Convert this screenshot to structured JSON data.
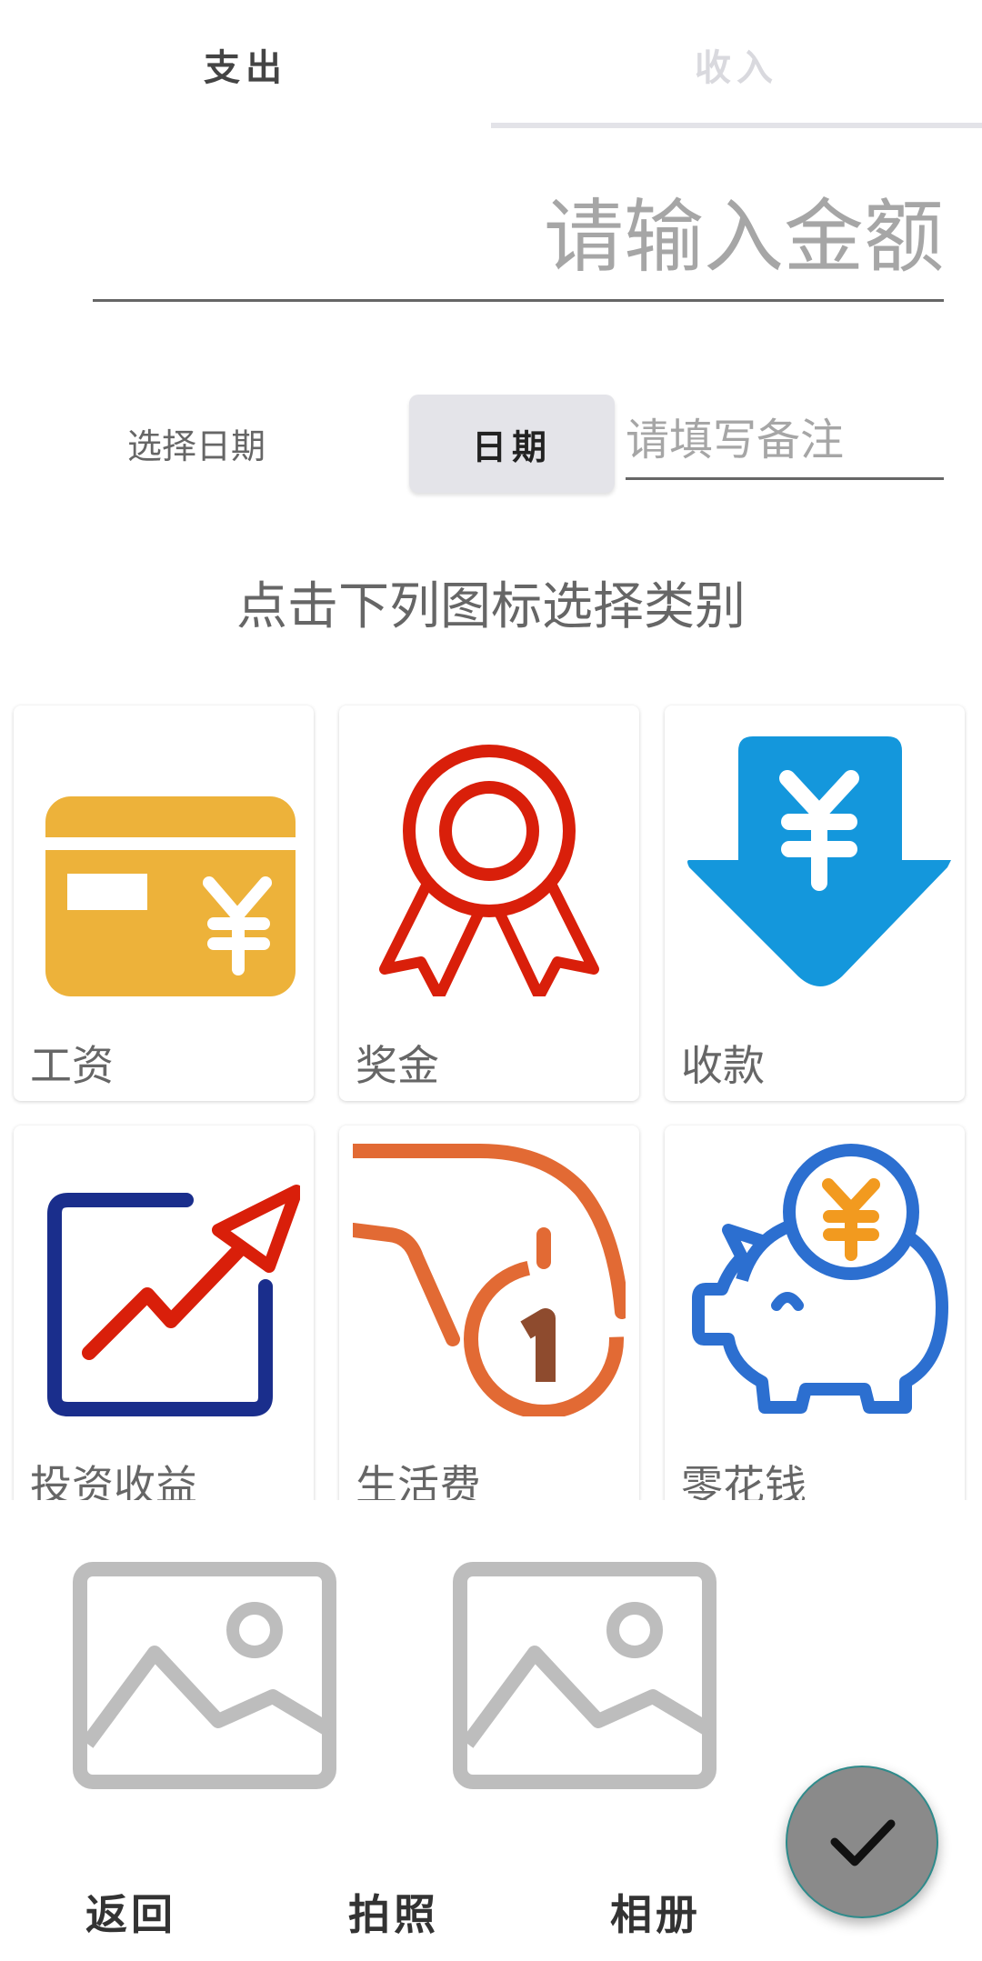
{
  "tabs": {
    "expense": "支出",
    "income": "收入"
  },
  "amount": {
    "placeholder": "请输入金额",
    "value": ""
  },
  "date": {
    "label": "选择日期",
    "button": "日期"
  },
  "remark": {
    "placeholder": "请填写备注",
    "value": ""
  },
  "hint": "点击下列图标选择类别",
  "categories": [
    {
      "label": "工资",
      "icon": "salary-card-icon",
      "color": "#EDB23A"
    },
    {
      "label": "奖金",
      "icon": "bonus-medal-icon",
      "color": "#D91F0A"
    },
    {
      "label": "收款",
      "icon": "receive-arrow-icon",
      "color": "#1497DC"
    },
    {
      "label": "投资收益",
      "icon": "investment-chart-icon",
      "color": "#1A2E8C"
    },
    {
      "label": "生活费",
      "icon": "living-cost-coin-hand-icon",
      "color": "#E26A34"
    },
    {
      "label": "零花钱",
      "icon": "piggy-bank-icon",
      "color": "#2C6FD0"
    }
  ],
  "photos": [
    {
      "icon": "image-placeholder-icon"
    },
    {
      "icon": "image-placeholder-icon"
    }
  ],
  "actions": {
    "back": "返回",
    "camera": "拍照",
    "album": "相册"
  },
  "fab": {
    "icon": "check-icon"
  }
}
